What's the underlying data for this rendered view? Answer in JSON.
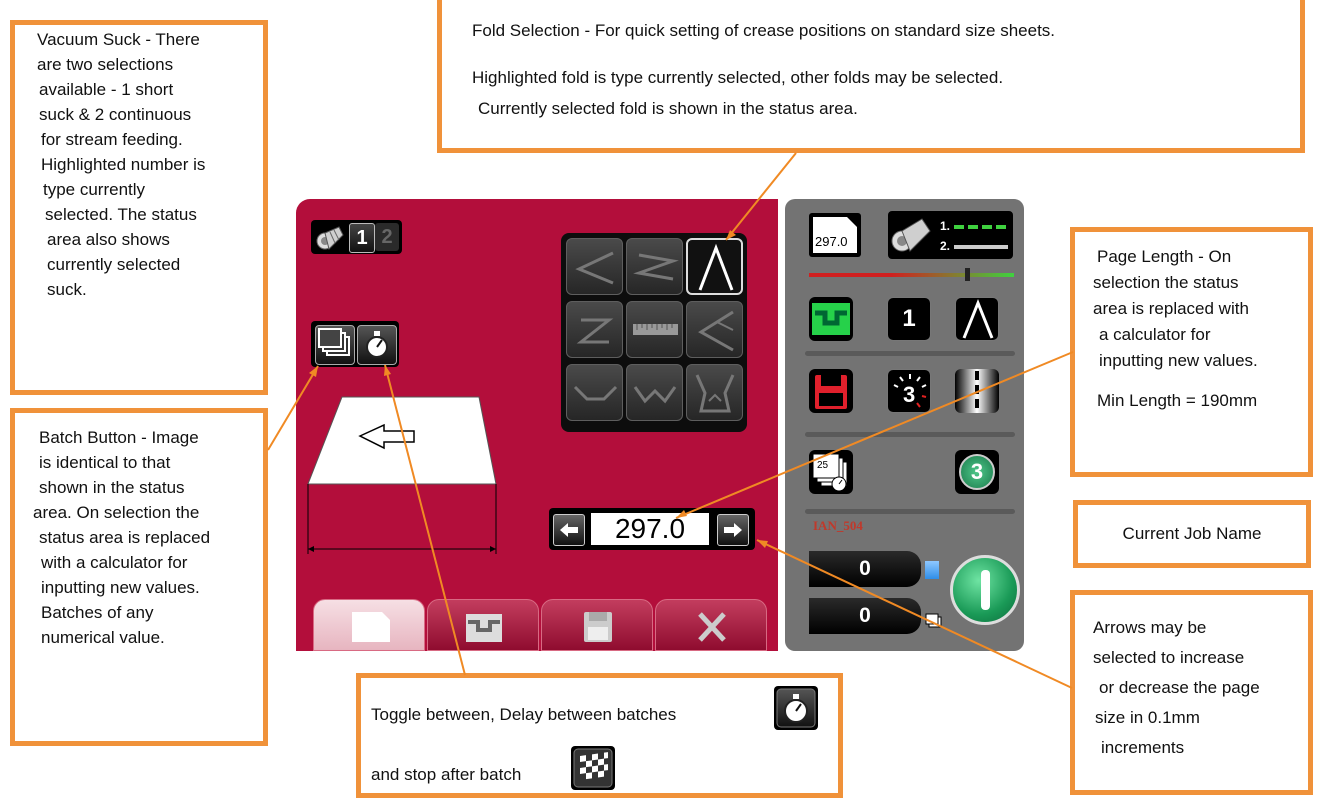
{
  "callouts": {
    "vacuum": [
      "Vacuum Suck - There",
      "are two selections",
      "available  - 1 short",
      "suck & 2 continuous",
      "for stream feeding.",
      "Highlighted number is",
      "type currently",
      "selected. The status",
      "area also shows",
      "currently selected",
      "suck."
    ],
    "batch": [
      "Batch Button - Image",
      "is identical to that",
      "shown in the status",
      "area. On selection the",
      "status area is replaced",
      "with a calculator for",
      "inputting new values.",
      "Batches of any",
      "numerical value."
    ],
    "fold_line1": "Fold Selection -  For quick setting of crease positions on standard size sheets.",
    "fold_line2": "Highlighted fold is type currently selected, other folds may be selected.",
    "fold_line3": "Currently selected fold is shown in the status area.",
    "page_length": [
      "Page Length  -  On",
      "selection the status",
      "area is replaced with",
      "a calculator for",
      "inputting new values."
    ],
    "min_length": "Min Length = 190mm",
    "job_name_label": "Current Job Name",
    "arrows": [
      "Arrows may be",
      "selected to increase",
      "or decrease the page",
      "size in 0.1mm",
      "increments"
    ],
    "toggle_line1": "Toggle between, Delay between batches",
    "toggle_line2": "and stop after batch"
  },
  "main_panel": {
    "suck_options": [
      "1",
      "2"
    ],
    "selected_suck": "1",
    "page_length_value": "297.0",
    "tabs": [
      "page-tab",
      "crease-tab",
      "save-tab",
      "tools-tab"
    ],
    "active_tab": "page-tab",
    "fold_grid": [
      "fold-1",
      "fold-2",
      "fold-3",
      "fold-4",
      "ruler",
      "fold-6",
      "fold-7",
      "fold-8",
      "fold-9"
    ],
    "selected_fold": "fold-3"
  },
  "status_panel": {
    "page_size_label": "297.0",
    "suck_level_1": "1.",
    "suck_level_2": "2.",
    "selected_suck": "1",
    "delay_count": "3",
    "batch_count": "25",
    "circle_badge": "3",
    "job_name": "IAN_504",
    "counter_sheets": "0",
    "counter_batches": "0"
  },
  "colors": {
    "main_bg": "#b30e3b",
    "status_bg": "#737373",
    "callout_border": "#f0923a",
    "leader_line": "#f08a24",
    "job_name": "#c0392b"
  }
}
